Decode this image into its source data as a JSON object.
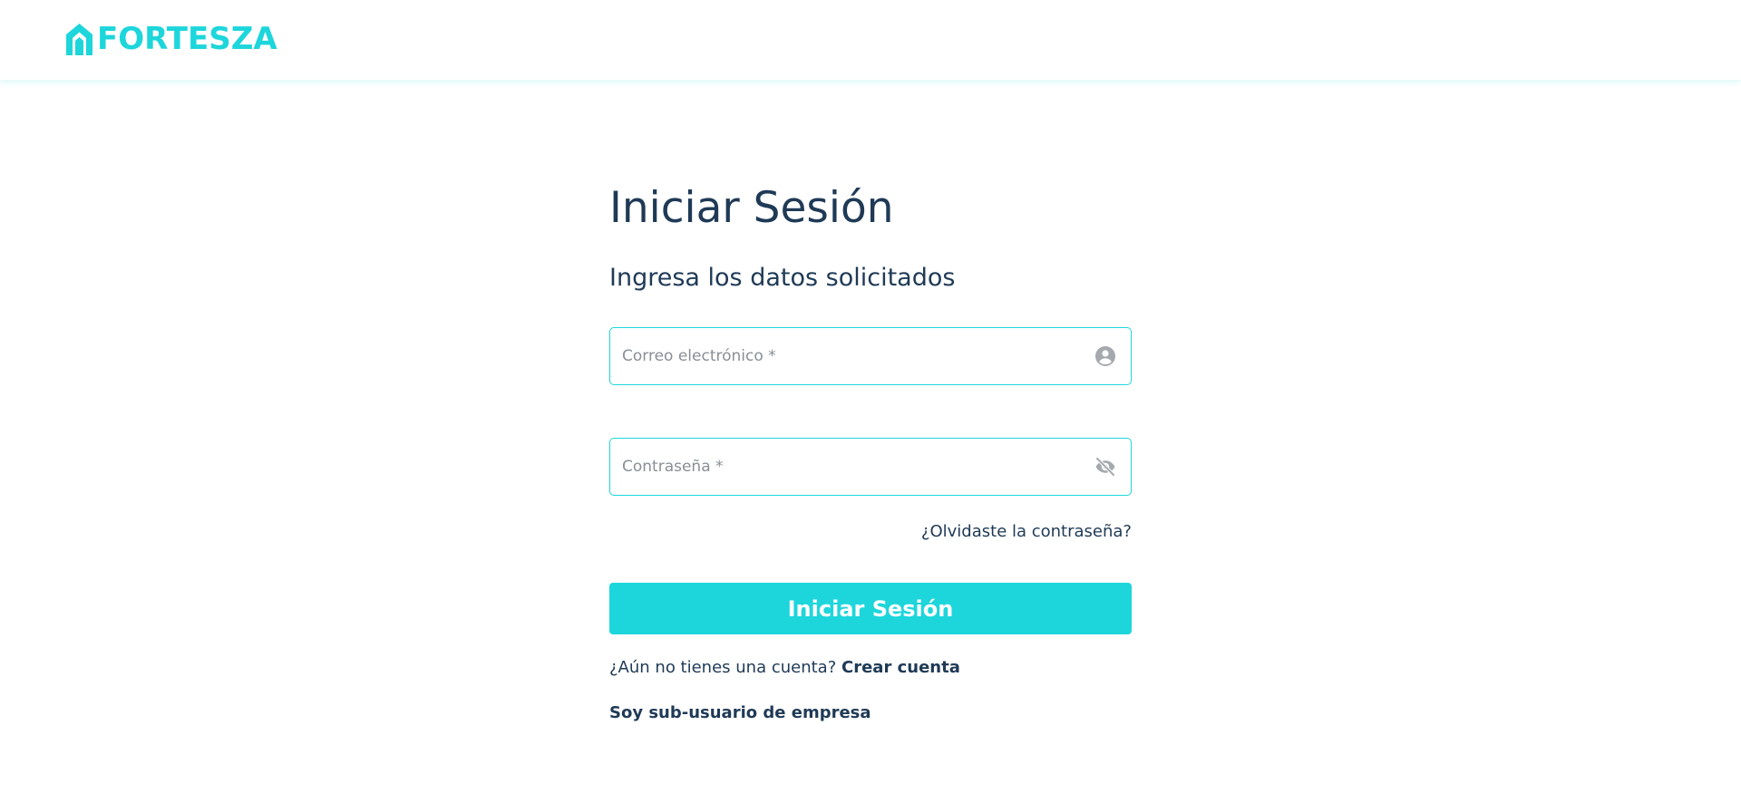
{
  "brand": {
    "name": "FORTESZA",
    "accent_color": "#1dd6db",
    "text_color": "#1f3a56"
  },
  "login": {
    "title": "Iniciar Sesión",
    "subtitle": "Ingresa los datos solicitados",
    "email": {
      "placeholder": "Correo electrónico *",
      "value": "",
      "icon": "account-circle-icon"
    },
    "password": {
      "placeholder": "Contraseña *",
      "value": "",
      "icon": "eye-off-icon"
    },
    "forgot_password": "¿Olvidaste la contraseña?",
    "submit_label": "Iniciar Sesión",
    "no_account_text": "¿Aún no tienes una cuenta?",
    "create_account": "Crear cuenta",
    "sub_user_link": "Soy sub-usuario de empresa"
  }
}
